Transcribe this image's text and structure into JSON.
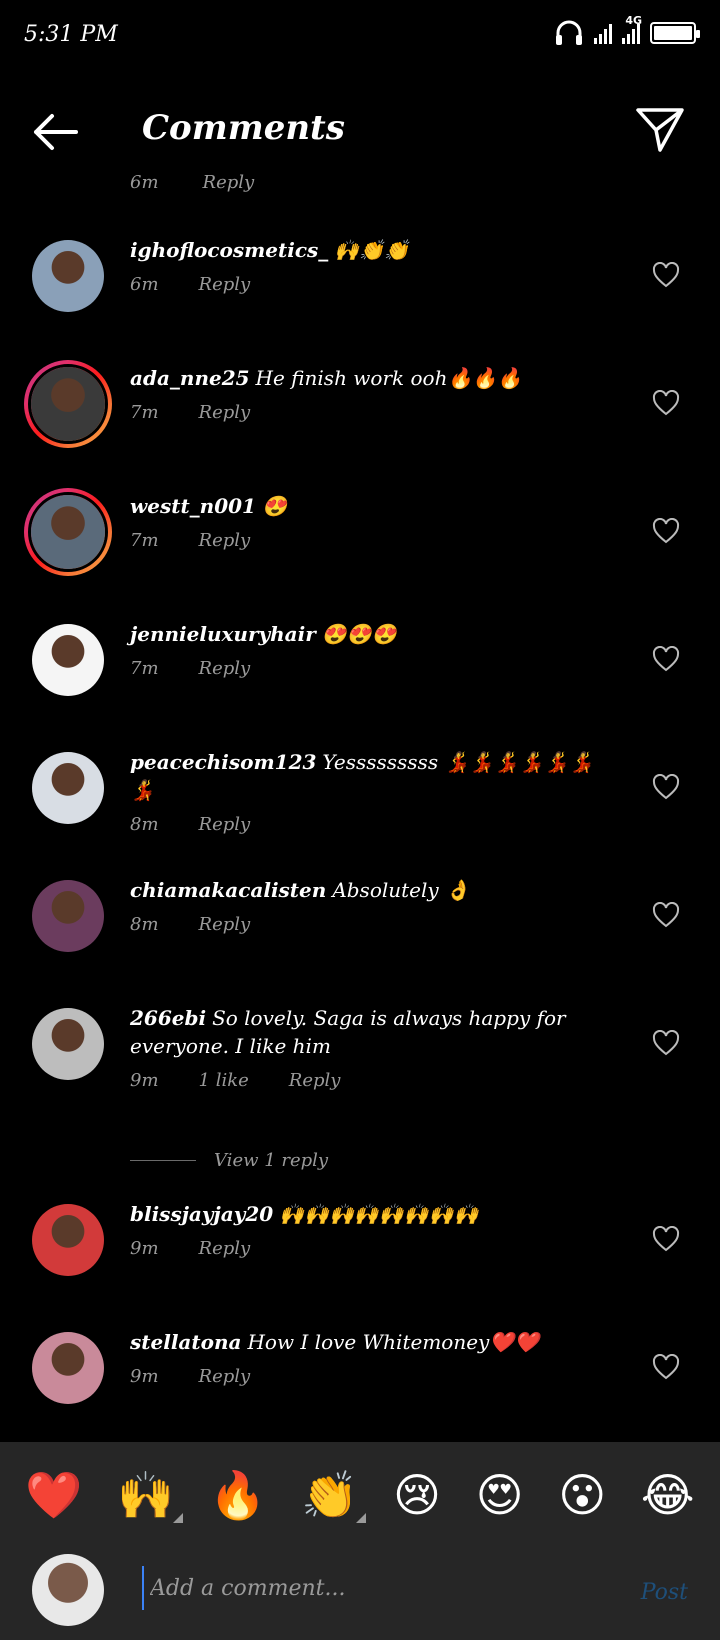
{
  "status_bar": {
    "time": "5:31 PM",
    "network": "4G"
  },
  "header": {
    "title": "Comments"
  },
  "partial_row": {
    "time": "6m",
    "reply": "Reply"
  },
  "comments": [
    {
      "user": "ighoflocosmetics_",
      "text": "🙌👏👏",
      "time": "6m",
      "likes": "",
      "reply": "Reply",
      "story_ring": false,
      "avatar_color": "#8aa0b8"
    },
    {
      "user": "ada_nne25",
      "text": "He finish work ooh🔥🔥🔥",
      "time": "7m",
      "likes": "",
      "reply": "Reply",
      "story_ring": true,
      "avatar_color": "#3a3a3a"
    },
    {
      "user": "westt_n001",
      "text": "😍",
      "time": "7m",
      "likes": "",
      "reply": "Reply",
      "story_ring": true,
      "avatar_color": "#5a6a7a"
    },
    {
      "user": "jennieluxuryhair",
      "text": "😍😍😍",
      "time": "7m",
      "likes": "",
      "reply": "Reply",
      "story_ring": false,
      "avatar_color": "#f5f5f5"
    },
    {
      "user": "peacechisom123",
      "text": "Yesssssssss 💃💃💃💃💃💃💃",
      "time": "8m",
      "likes": "",
      "reply": "Reply",
      "story_ring": false,
      "avatar_color": "#d8dde4"
    },
    {
      "user": "chiamakacalisten",
      "text": "Absolutely 👌",
      "time": "8m",
      "likes": "",
      "reply": "Reply",
      "story_ring": false,
      "avatar_color": "#6b3c5e"
    },
    {
      "user": "266ebi",
      "text": "So lovely. Saga is always happy for everyone. I like him",
      "time": "9m",
      "likes": "1 like",
      "reply": "Reply",
      "story_ring": false,
      "avatar_color": "#bdbdbd"
    },
    {
      "user": "blissjayjay20",
      "text": "🙌🙌🙌🙌🙌🙌🙌🙌",
      "time": "9m",
      "likes": "",
      "reply": "Reply",
      "story_ring": false,
      "avatar_color": "#d23a3a"
    },
    {
      "user": "stellatona",
      "text": "How I love Whitemoney❤️❤️",
      "time": "9m",
      "likes": "",
      "reply": "Reply",
      "story_ring": false,
      "avatar_color": "#c98a9a"
    }
  ],
  "view_replies": {
    "label": "View 1 reply"
  },
  "quick_emojis": [
    "❤️",
    "🙌",
    "🔥",
    "👏",
    "😢",
    "😍",
    "😮",
    "😂"
  ],
  "composer": {
    "placeholder": "Add a comment...",
    "post_label": "Post"
  },
  "colors": {
    "background": "#000000",
    "bar": "#262626",
    "meta": "#9a9a9a",
    "post": "#1e4f7a"
  }
}
